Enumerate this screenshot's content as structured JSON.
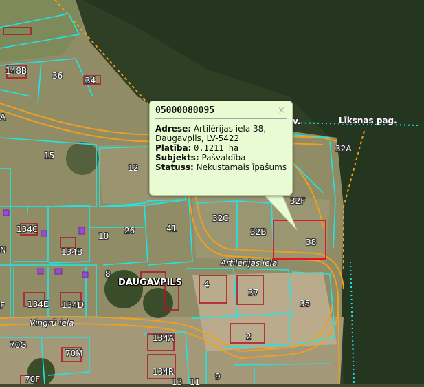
{
  "popup": {
    "title": "05000080095",
    "close_symbol": "×",
    "fields": [
      {
        "label": "Adrese:",
        "value": "Artilērijas iela 38, Daugavpils, LV-5422"
      },
      {
        "label": "Platība:",
        "value": "0.1211 ha"
      },
      {
        "label": "Subjekts:",
        "value": "Pašvaldība"
      },
      {
        "label": "Statuss:",
        "value": "Nekustamais īpašums"
      }
    ]
  },
  "labels": {
    "town": "DAUGAVPILS",
    "parish_cut": "v.",
    "parish": "Līksnas pag.",
    "street_artilerijas": "Artilērijas iela",
    "street_vingru": "Vingrū iela",
    "parcels": {
      "p148B": "148B",
      "p36": "36",
      "p34": "34",
      "p15": "15",
      "p12": "12",
      "p32A": "32A",
      "p32F": "32F",
      "p32C": "32C",
      "p32B": "32B",
      "p38": "38",
      "p41": "41",
      "p26": "26",
      "p10": "10",
      "p134C": "134C",
      "p134B": "134B",
      "p8": "8",
      "p4": "4",
      "p37": "37",
      "p134E": "134E",
      "p134D": "134D",
      "p35": "35",
      "p2": "2",
      "p134A": "134A",
      "p70G": "70G",
      "p70M": "70M",
      "p70F": "70F",
      "p134R": "134R",
      "p13": "13",
      "p11": "11",
      "p9": "9",
      "pA": "A",
      "pN": "N",
      "pF": "F"
    }
  },
  "colors": {
    "parcel_line": "#1fe6e6",
    "selected_parcel": "#e8141e",
    "road": "#f0a020",
    "admin_boundary": "#f0a020",
    "popup_bg": "#e8fbd2"
  }
}
